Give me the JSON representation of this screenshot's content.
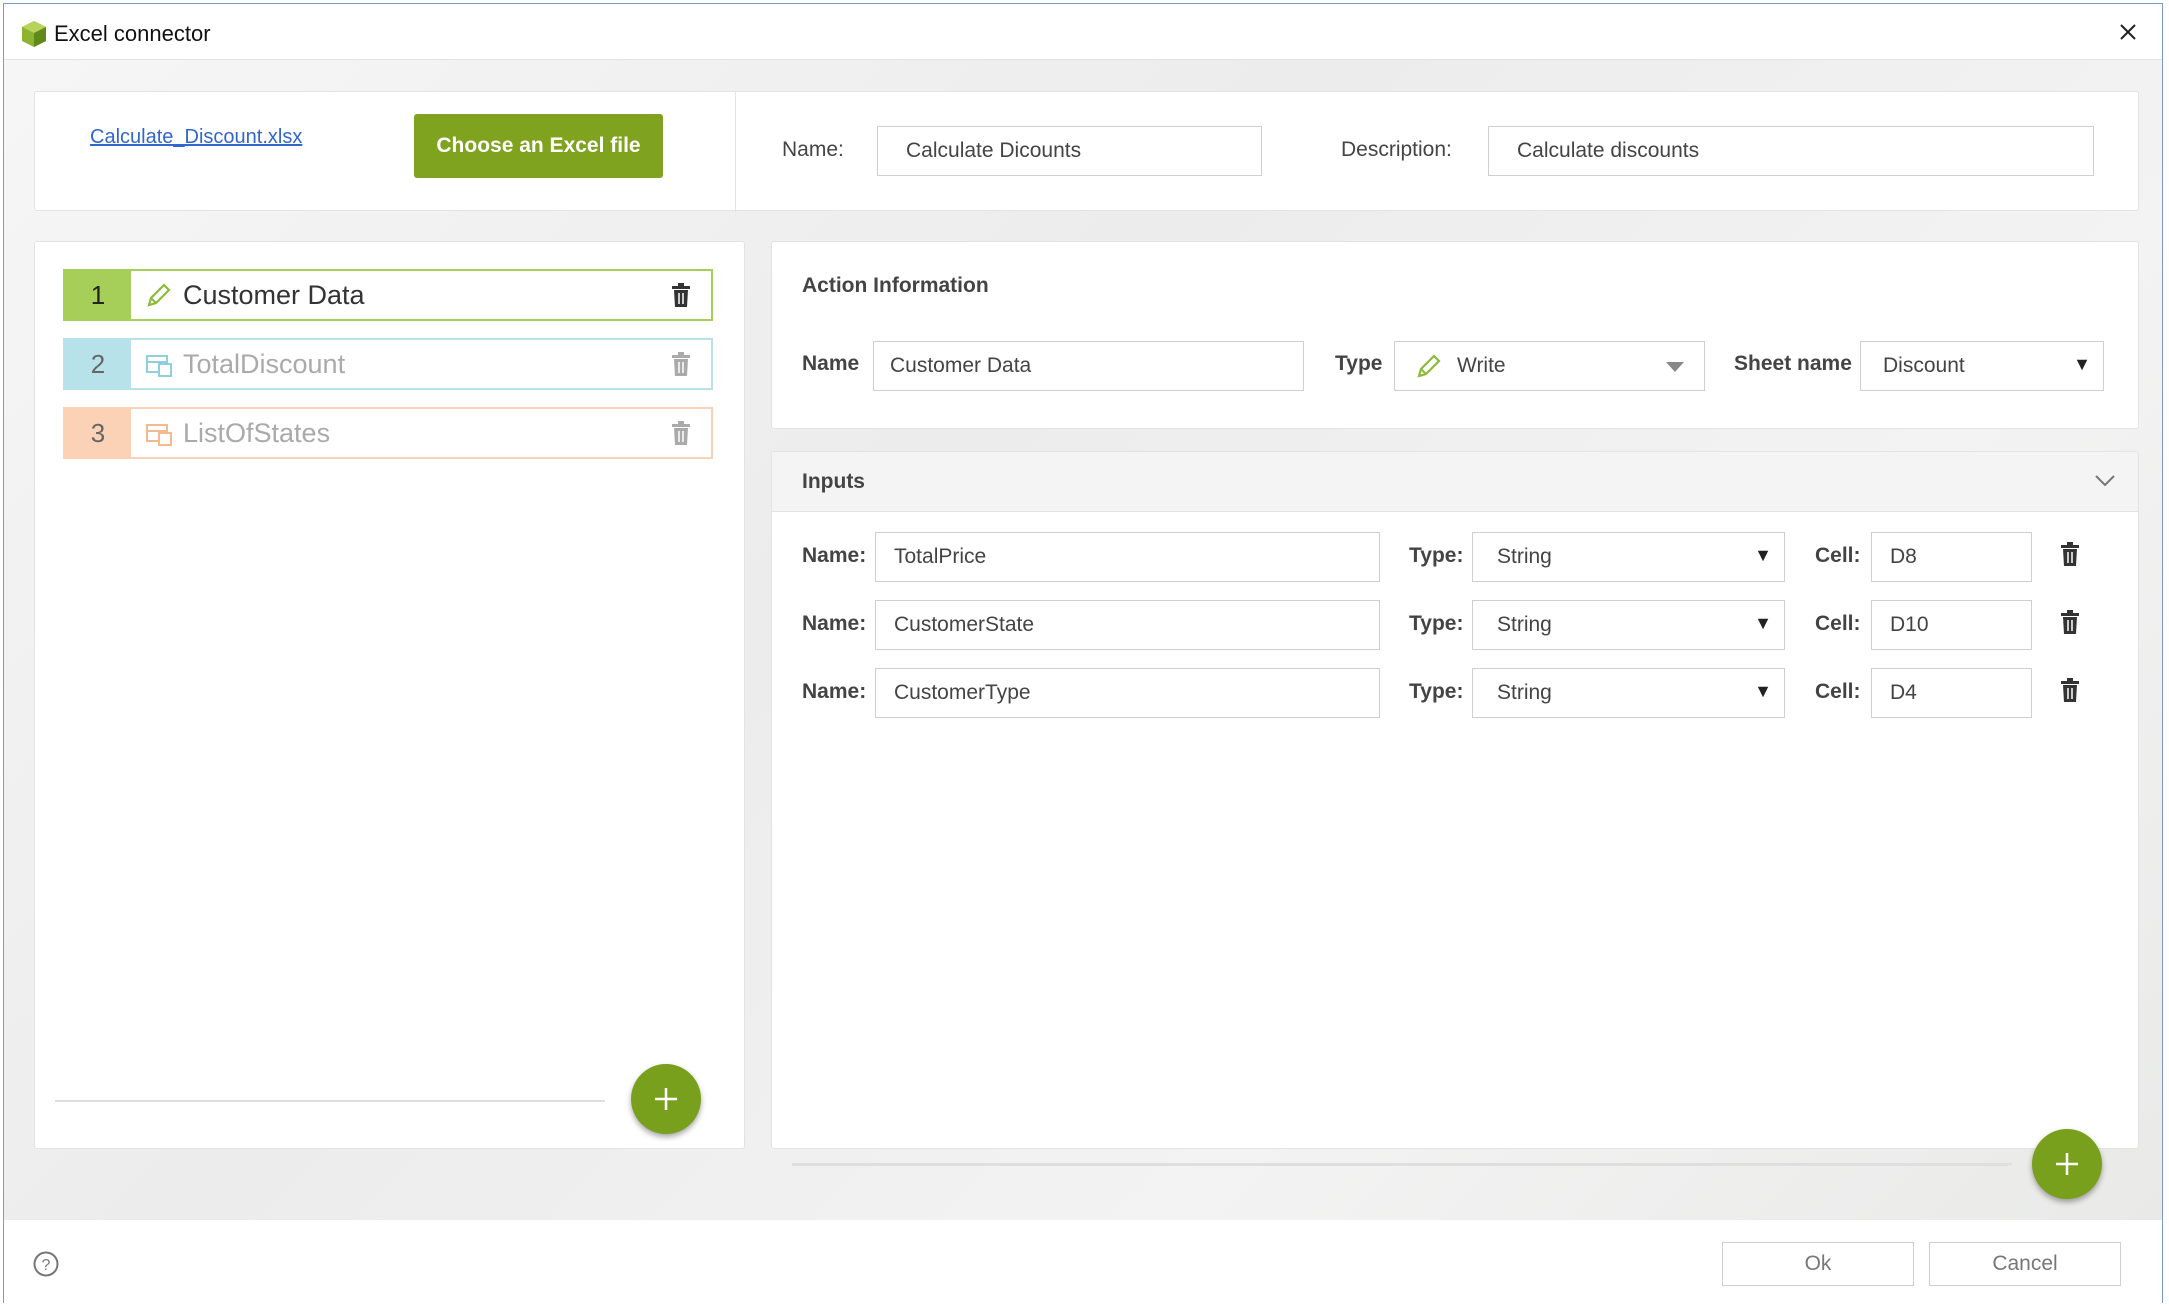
{
  "window": {
    "title": "Excel connector"
  },
  "top": {
    "file_link": "Calculate_Discount.xlsx",
    "choose_button": "Choose an Excel file",
    "name_label": "Name:",
    "name_value": "Calculate Dicounts",
    "description_label": "Description:",
    "description_value": "Calculate discounts"
  },
  "actions": [
    {
      "number": "1",
      "name": "Customer Data",
      "icon": "pencil-icon",
      "color": "#a6cf5a",
      "selected": true
    },
    {
      "number": "2",
      "name": "TotalDiscount",
      "icon": "read-cells-icon",
      "color": "#b8e2ea",
      "selected": false
    },
    {
      "number": "3",
      "name": "ListOfStates",
      "icon": "read-range-icon",
      "color": "#fbd2b5",
      "selected": false
    }
  ],
  "action_info": {
    "title": "Action Information",
    "name_label": "Name",
    "name_value": "Customer Data",
    "type_label": "Type",
    "type_value": "Write",
    "sheet_label": "Sheet name",
    "sheet_value": "Discount"
  },
  "inputs": {
    "title": "Inputs",
    "name_label": "Name:",
    "type_label": "Type:",
    "cell_label": "Cell:",
    "rows": [
      {
        "name": "TotalPrice",
        "type": "String",
        "cell": "D8"
      },
      {
        "name": "CustomerState",
        "type": "String",
        "cell": "D10"
      },
      {
        "name": "CustomerType",
        "type": "String",
        "cell": "D4"
      }
    ]
  },
  "footer": {
    "ok_label": "Ok",
    "cancel_label": "Cancel"
  },
  "colors": {
    "accent_green": "#7fa31f",
    "link_blue": "#3366cc"
  }
}
